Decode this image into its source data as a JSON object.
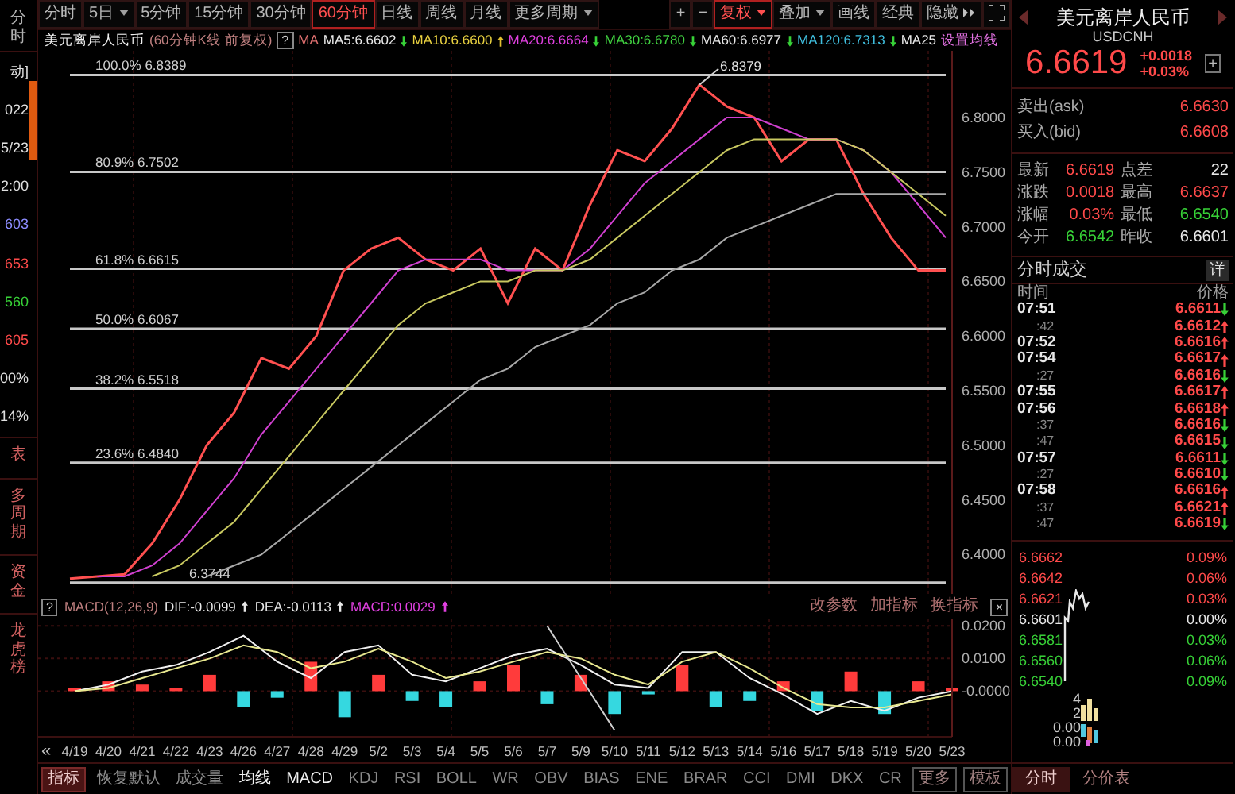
{
  "left_strip": {
    "tab": "分时",
    "values": [
      {
        "text": "动]",
        "color": "#e0e0e0"
      },
      {
        "text": "022",
        "color": "#e0e0e0"
      },
      {
        "text": "5/23",
        "color": "#e0e0e0"
      },
      {
        "text": "2:00",
        "color": "#e0e0e0"
      },
      {
        "text": "603",
        "color": "#8c8cff"
      },
      {
        "text": "653",
        "color": "#ff4a4a"
      },
      {
        "text": "560",
        "color": "#37d137"
      },
      {
        "text": "605",
        "color": "#ff4a4a"
      },
      {
        "text": "00%",
        "color": "#e0e0e0"
      },
      {
        "text": "14%",
        "color": "#e0e0e0"
      }
    ],
    "side_tabs": [
      "表",
      "多周期",
      "资金",
      "龙虎榜"
    ]
  },
  "toolbar": {
    "periods": [
      {
        "label": "分时",
        "selected": false,
        "dropdown": false
      },
      {
        "label": "5日",
        "selected": false,
        "dropdown": true
      },
      {
        "label": "5分钟",
        "selected": false,
        "dropdown": false
      },
      {
        "label": "15分钟",
        "selected": false,
        "dropdown": false
      },
      {
        "label": "30分钟",
        "selected": false,
        "dropdown": false
      },
      {
        "label": "60分钟",
        "selected": true,
        "dropdown": false
      },
      {
        "label": "日线",
        "selected": false,
        "dropdown": false
      },
      {
        "label": "周线",
        "selected": false,
        "dropdown": false
      },
      {
        "label": "月线",
        "selected": false,
        "dropdown": false
      },
      {
        "label": "更多周期",
        "selected": false,
        "dropdown": true
      }
    ],
    "tools": [
      {
        "label": "+",
        "selected": false,
        "dropdown": false,
        "expand": false
      },
      {
        "label": "−",
        "selected": false,
        "dropdown": false,
        "expand": false
      },
      {
        "label": "复权",
        "selected": true,
        "dropdown": true,
        "expand": false
      },
      {
        "label": "叠加",
        "selected": false,
        "dropdown": true,
        "expand": false
      },
      {
        "label": "画线",
        "selected": false,
        "dropdown": false,
        "expand": false
      },
      {
        "label": "经典",
        "selected": false,
        "dropdown": false,
        "expand": false
      },
      {
        "label": "隐藏",
        "selected": false,
        "dropdown": false,
        "expand": true
      }
    ]
  },
  "ma_row": {
    "symbol": "美元离岸人民币",
    "period": "(60分钟K线 前复权)",
    "help": "?",
    "label": "MA",
    "items": [
      {
        "text": "MA5:6.6602",
        "color": "#e8e8e8",
        "arrow": true,
        "rising": false
      },
      {
        "text": "MA10:6.6600",
        "color": "#e8d040",
        "arrow": true,
        "rising": true
      },
      {
        "text": "MA20:6.6664",
        "color": "#e040e0",
        "arrow": true,
        "rising": false
      },
      {
        "text": "MA30:6.6780",
        "color": "#40d040",
        "arrow": true,
        "rising": false
      },
      {
        "text": "MA60:6.6977",
        "color": "#e8e8e8",
        "arrow": true,
        "rising": false
      },
      {
        "text": "MA120:6.7313",
        "color": "#40c0e0",
        "arrow": true,
        "rising": false
      },
      {
        "text": "MA25",
        "color": "#e8e8e8",
        "arrow": false
      }
    ],
    "settings": "设置均线"
  },
  "main_chart": {
    "chart_data": {
      "type": "line",
      "ylim": [
        6.364,
        6.861
      ],
      "grid": true,
      "yticks": [
        {
          "value": 6.8,
          "label": "6.8000"
        },
        {
          "value": 6.75,
          "label": "6.7500"
        },
        {
          "value": 6.7,
          "label": "6.7000"
        },
        {
          "value": 6.65,
          "label": "6.6500"
        },
        {
          "value": 6.6,
          "label": "6.6000"
        },
        {
          "value": 6.55,
          "label": "6.5500"
        },
        {
          "value": 6.5,
          "label": "6.5000"
        },
        {
          "value": 6.45,
          "label": "6.4500"
        },
        {
          "value": 6.4,
          "label": "6.4000"
        }
      ],
      "series": [
        {
          "color": "#ff5050",
          "values": [
            6.378,
            6.38,
            6.382,
            6.41,
            6.45,
            6.5,
            6.53,
            6.58,
            6.57,
            6.6,
            6.66,
            6.68,
            6.69,
            6.67,
            6.66,
            6.68,
            6.63,
            6.68,
            6.66,
            6.72,
            6.77,
            6.76,
            6.79,
            6.83,
            6.81,
            6.8,
            6.76,
            6.78,
            6.78,
            6.73,
            6.69,
            6.66,
            6.66
          ]
        },
        {
          "color": "#d040d0",
          "values": [
            null,
            6.38,
            6.38,
            6.39,
            6.41,
            6.44,
            6.47,
            6.51,
            6.54,
            6.57,
            6.6,
            6.63,
            6.66,
            6.67,
            6.67,
            6.67,
            6.66,
            6.66,
            6.66,
            6.68,
            6.71,
            6.74,
            6.76,
            6.78,
            6.8,
            6.8,
            6.79,
            6.78,
            6.78,
            6.77,
            6.75,
            6.72,
            6.69
          ]
        },
        {
          "color": "#c8c860",
          "values": [
            null,
            null,
            null,
            6.38,
            6.39,
            6.41,
            6.43,
            6.46,
            6.49,
            6.52,
            6.55,
            6.58,
            6.61,
            6.63,
            6.64,
            6.65,
            6.65,
            6.66,
            6.66,
            6.67,
            6.69,
            6.71,
            6.73,
            6.75,
            6.77,
            6.78,
            6.78,
            6.78,
            6.78,
            6.77,
            6.75,
            6.73,
            6.71
          ]
        },
        {
          "color": "#a8a8a8",
          "values": [
            null,
            null,
            null,
            null,
            null,
            6.38,
            6.39,
            6.4,
            6.42,
            6.44,
            6.46,
            6.48,
            6.5,
            6.52,
            6.54,
            6.56,
            6.57,
            6.59,
            6.6,
            6.61,
            6.63,
            6.64,
            6.66,
            6.67,
            6.69,
            6.7,
            6.71,
            6.72,
            6.73,
            6.73,
            6.73,
            6.73,
            6.73
          ]
        }
      ],
      "ref_lines": [
        {
          "axis": "y",
          "value": 6.8389,
          "label": "100.0% 6.8389"
        },
        {
          "axis": "y",
          "value": 6.7502,
          "label": "80.9% 6.7502"
        },
        {
          "axis": "y",
          "value": 6.6615,
          "label": "61.8% 6.6615"
        },
        {
          "axis": "y",
          "value": 6.6067,
          "label": "50.0% 6.6067"
        },
        {
          "axis": "y",
          "value": 6.5518,
          "label": "38.2% 6.5518"
        },
        {
          "axis": "y",
          "value": 6.484,
          "label": "23.6% 6.4840"
        },
        {
          "axis": "y",
          "value": 6.3744,
          "label": "6.3744"
        }
      ],
      "annotations": [
        {
          "text": "6.8379"
        }
      ]
    }
  },
  "macd_header": {
    "help": "?",
    "items": [
      {
        "text": "MACD(12,26,9)",
        "color": "#c08080",
        "arrow": false
      },
      {
        "text": "DIF:-0.0099",
        "color": "#e8e8e8",
        "arrow": true
      },
      {
        "text": "DEA:-0.0113",
        "color": "#e8e8e8",
        "arrow": true
      },
      {
        "text": "MACD:0.0029",
        "color": "#e040e0",
        "arrow": true
      }
    ],
    "actions": [
      "改参数",
      "加指标",
      "换指标"
    ],
    "close": "×"
  },
  "macd_chart": {
    "scroll_button": "«",
    "chart_data": {
      "type": "bar",
      "ylim": [
        -0.014,
        0.022
      ],
      "grid": true,
      "categories": [
        "4/19",
        "4/20",
        "4/21",
        "4/22",
        "4/23",
        "4/26",
        "4/27",
        "4/28",
        "4/29",
        "5/2",
        "5/3",
        "5/4",
        "5/5",
        "5/6",
        "5/7",
        "5/9",
        "5/10",
        "5/11",
        "5/12",
        "5/13",
        "5/14",
        "5/16",
        "5/17",
        "5/18",
        "5/19",
        "5/20",
        "5/23"
      ],
      "yticks": [
        {
          "value": 0.02,
          "label": "0.0200"
        },
        {
          "value": 0.01,
          "label": "0.0100"
        },
        {
          "value": 0,
          "label": "-0.0000"
        }
      ],
      "series": [
        {
          "color": "#ff3b3b",
          "values": [
            0.001,
            0.003,
            0.002,
            0.001,
            0.005,
            null,
            null,
            0.009,
            null,
            0.005,
            null,
            null,
            0.003,
            0.008,
            null,
            0.005,
            null,
            null,
            0.008,
            null,
            null,
            0.003,
            null,
            0.006,
            null,
            0.003,
            0.001
          ]
        },
        {
          "color": "#35d8e0",
          "values": [
            null,
            null,
            null,
            null,
            null,
            -0.005,
            -0.002,
            null,
            -0.008,
            null,
            -0.003,
            -0.005,
            null,
            null,
            -0.004,
            null,
            -0.007,
            -0.001,
            null,
            -0.005,
            -0.003,
            null,
            -0.006,
            null,
            -0.007,
            null,
            null
          ]
        },
        {
          "type": "line",
          "color": "#f0f0f0",
          "values": [
            0,
            0.002,
            0.006,
            0.008,
            0.012,
            0.017,
            0.009,
            0.004,
            0.012,
            0.014,
            0.005,
            0.003,
            0.007,
            0.011,
            0.013,
            0.008,
            0.002,
            0.001,
            0.012,
            0.012,
            0.004,
            -0.001,
            -0.007,
            -0.003,
            -0.006,
            -0.002,
            0
          ]
        },
        {
          "type": "line",
          "color": "#e8e890",
          "values": [
            0,
            0.001,
            0.004,
            0.007,
            0.01,
            0.014,
            0.012,
            0.007,
            0.009,
            0.013,
            0.009,
            0.004,
            0.006,
            0.009,
            0.012,
            0.01,
            0.005,
            0.002,
            0.009,
            0.012,
            0.007,
            0.001,
            -0.004,
            -0.005,
            -0.005,
            -0.003,
            -0.001
          ]
        },
        {
          "type": "line",
          "color": "#d0d0d0",
          "values": [
            null,
            null,
            null,
            null,
            null,
            null,
            null,
            null,
            null,
            null,
            null,
            null,
            null,
            null,
            0.02,
            0.004,
            -0.012,
            null,
            null,
            null,
            null,
            null,
            null,
            null,
            null,
            null,
            null
          ]
        }
      ]
    }
  },
  "indicator_tabs": [
    {
      "label": "指标",
      "selected": true,
      "active": false,
      "kind": "tab"
    },
    {
      "label": "恢复默认",
      "selected": false,
      "active": false,
      "kind": "tab"
    },
    {
      "label": "成交量",
      "selected": false,
      "active": false,
      "kind": "tab"
    },
    {
      "label": "均线",
      "selected": false,
      "active": true,
      "kind": "tab"
    },
    {
      "label": "MACD",
      "selected": false,
      "active": true,
      "kind": "tab"
    },
    {
      "label": "KDJ",
      "selected": false,
      "active": false,
      "kind": "tab"
    },
    {
      "label": "RSI",
      "selected": false,
      "active": false,
      "kind": "tab"
    },
    {
      "label": "BOLL",
      "selected": false,
      "active": false,
      "kind": "tab"
    },
    {
      "label": "WR",
      "selected": false,
      "active": false,
      "kind": "tab"
    },
    {
      "label": "OBV",
      "selected": false,
      "active": false,
      "kind": "tab"
    },
    {
      "label": "BIAS",
      "selected": false,
      "active": false,
      "kind": "tab"
    },
    {
      "label": "ENE",
      "selected": false,
      "active": false,
      "kind": "tab"
    },
    {
      "label": "BRAR",
      "selected": false,
      "active": false,
      "kind": "tab"
    },
    {
      "label": "CCI",
      "selected": false,
      "active": false,
      "kind": "tab"
    },
    {
      "label": "DMI",
      "selected": false,
      "active": false,
      "kind": "tab"
    },
    {
      "label": "DKX",
      "selected": false,
      "active": false,
      "kind": "tab"
    },
    {
      "label": "CR",
      "selected": false,
      "active": false,
      "kind": "tab"
    },
    {
      "label": "更多",
      "selected": false,
      "active": false,
      "kind": "box"
    },
    {
      "label": "模板",
      "selected": false,
      "active": false,
      "kind": "box"
    }
  ],
  "quote": {
    "name": "美元离岸人民币",
    "code": "USDCNH",
    "price": "6.6619",
    "change": "+0.0018",
    "change_pct": "+0.03%",
    "add": "+"
  },
  "ask_bid": [
    {
      "label": "卖出(ask)",
      "value": "6.6630",
      "color": "#ff4a4a"
    },
    {
      "label": "买入(bid)",
      "value": "6.6608",
      "color": "#ff4a4a"
    }
  ],
  "stats": [
    [
      {
        "label": "最新",
        "value": "6.6619",
        "color": "#ff4a4a"
      },
      {
        "label": "点差",
        "value": "22",
        "color": "#e8e8e8"
      }
    ],
    [
      {
        "label": "涨跌",
        "value": "0.0018",
        "color": "#ff4a4a"
      },
      {
        "label": "最高",
        "value": "6.6637",
        "color": "#ff4a4a"
      }
    ],
    [
      {
        "label": "涨幅",
        "value": "0.03%",
        "color": "#ff4a4a"
      },
      {
        "label": "最低",
        "value": "6.6540",
        "color": "#37d137"
      }
    ],
    [
      {
        "label": "今开",
        "value": "6.6542",
        "color": "#37d137"
      },
      {
        "label": "昨收",
        "value": "6.6601",
        "color": "#e8e8e8"
      }
    ]
  ],
  "trades": {
    "title": "分时成交",
    "detail": "详",
    "columns": [
      "时间",
      "价格"
    ],
    "rows": [
      {
        "time": "07:51",
        "kind": "minute",
        "price": "6.6611",
        "rising": false
      },
      {
        "time": ":42",
        "kind": "second",
        "price": "6.6612",
        "rising": true
      },
      {
        "time": "07:52",
        "kind": "minute",
        "price": "6.6616",
        "rising": true
      },
      {
        "time": "07:54",
        "kind": "minute",
        "price": "6.6617",
        "rising": true
      },
      {
        "time": ":27",
        "kind": "second",
        "price": "6.6616",
        "rising": false
      },
      {
        "time": "07:55",
        "kind": "minute",
        "price": "6.6617",
        "rising": true
      },
      {
        "time": "07:56",
        "kind": "minute",
        "price": "6.6618",
        "rising": true
      },
      {
        "time": ":37",
        "kind": "second",
        "price": "6.6616",
        "rising": false
      },
      {
        "time": ":47",
        "kind": "second",
        "price": "6.6615",
        "rising": false
      },
      {
        "time": "07:57",
        "kind": "minute",
        "price": "6.6611",
        "rising": false
      },
      {
        "time": ":27",
        "kind": "second",
        "price": "6.6610",
        "rising": false
      },
      {
        "time": "07:58",
        "kind": "minute",
        "price": "6.6616",
        "rising": true
      },
      {
        "time": ":37",
        "kind": "second",
        "price": "6.6621",
        "rising": true
      },
      {
        "time": ":47",
        "kind": "second",
        "price": "6.6619",
        "rising": false
      }
    ]
  },
  "intraday": {
    "rows": [
      {
        "price": "6.6662",
        "pct": "0.09%",
        "color": "#ff4a4a"
      },
      {
        "price": "6.6642",
        "pct": "0.06%",
        "color": "#ff4a4a"
      },
      {
        "price": "6.6621",
        "pct": "0.03%",
        "color": "#ff4a4a"
      },
      {
        "price": "6.6601",
        "pct": "0.00%",
        "color": "#e8e8e8"
      },
      {
        "price": "6.6581",
        "pct": "0.03%",
        "color": "#37d137"
      },
      {
        "price": "6.6560",
        "pct": "0.06%",
        "color": "#37d137"
      },
      {
        "price": "6.6540",
        "pct": "0.09%",
        "color": "#37d137"
      }
    ],
    "volume_labels": [
      "4",
      "2",
      "0.00",
      "0.00"
    ]
  },
  "bottom_tabs": [
    {
      "label": "分时",
      "selected": true
    },
    {
      "label": "分价表",
      "selected": false
    }
  ]
}
